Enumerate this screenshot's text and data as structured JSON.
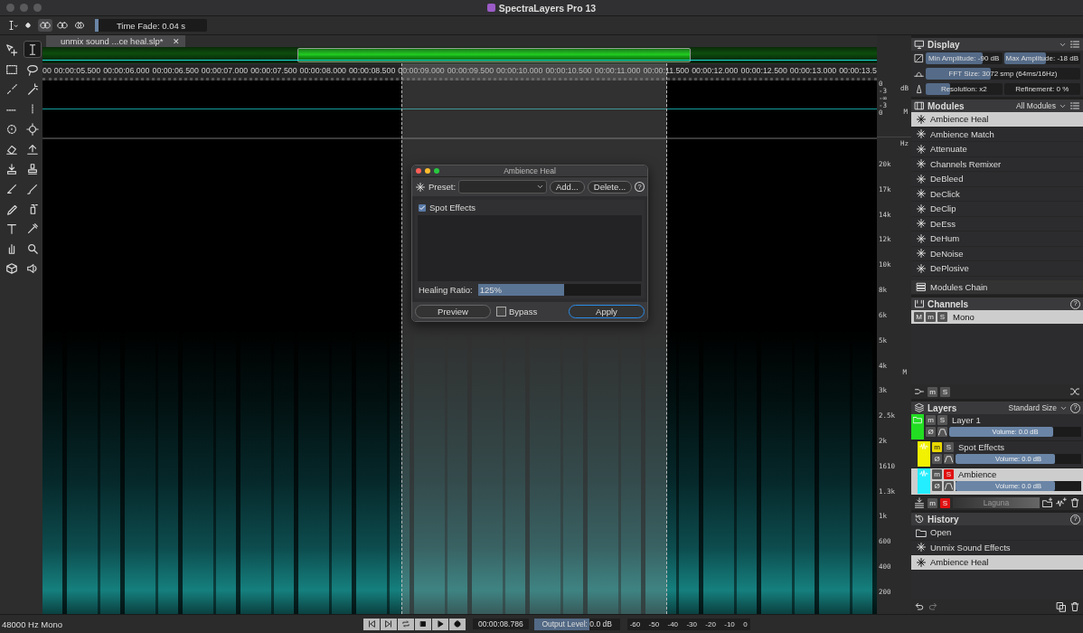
{
  "window": {
    "title": "SpectraLayers Pro 13"
  },
  "toolbar": {
    "modes": [
      {
        "selected": false
      },
      {
        "selected": true
      },
      {
        "selected": false
      },
      {
        "selected": false
      }
    ],
    "time_fade": {
      "text": "Time Fade: 0.04  s",
      "level": 0.03
    }
  },
  "tools": [
    {
      "selected": false
    },
    {
      "selected": true
    },
    {
      "selected": false
    },
    {
      "selected": false
    },
    {
      "selected": false
    },
    {
      "selected": false
    },
    {
      "selected": false
    },
    {
      "selected": false
    },
    {
      "selected": false
    },
    {
      "selected": false
    },
    {
      "selected": false
    },
    {
      "selected": false
    },
    {
      "selected": false
    },
    {
      "selected": false
    },
    {
      "selected": false
    },
    {
      "selected": false
    },
    {
      "selected": false
    },
    {
      "selected": false
    },
    {
      "selected": false
    },
    {
      "selected": false
    },
    {
      "selected": false
    },
    {
      "selected": false
    },
    {
      "selected": false
    },
    {
      "selected": false
    }
  ],
  "tab": {
    "label": "unmix sound ...ce heal.slp*",
    "close": "✕"
  },
  "ruler": {
    "labels": [
      "00",
      "00:00:05.500",
      "00:00:06.000",
      "00:00:06.500",
      "00:00:07.000",
      "00:00:07.500",
      "00:00:08.000",
      "00:00:08.500",
      "00:00:09.000",
      "00:00:09.500",
      "00:00:10.000",
      "00:00:10.500",
      "00:00:11.000",
      "00:00:11.500",
      "00:00:12.000",
      "00:00:12.500",
      "00:00:13.000",
      "00:00:13.5"
    ]
  },
  "waveform": {
    "unit": "dB",
    "channel": "M",
    "db_labels": [
      "0",
      "-3",
      "-∞",
      "-3",
      "0"
    ]
  },
  "frequency_axis": {
    "unit": "Hz",
    "channel": "M",
    "labels": [
      "20k",
      "17k",
      "14k",
      "12k",
      "10k",
      "8k",
      "6k",
      "5k",
      "4k",
      "3k",
      "2.5k",
      "2k",
      "1610",
      "1.3k",
      "1k",
      "600",
      "400",
      "200"
    ]
  },
  "display": {
    "title": "Display",
    "rows": [
      [
        {
          "kind": "slider",
          "text": "Min Amplitude: -90 dB",
          "level": 0.75
        },
        {
          "kind": "slider",
          "text": "Max Amplitude: -18 dB",
          "level": 0.55
        }
      ],
      [
        {
          "kind": "slider",
          "text": "FFT Size: 3072 smp (64ms/16Hz)",
          "level": 0.42
        }
      ],
      [
        {
          "kind": "slider",
          "text": "Resolution: x2",
          "level": 0.32
        },
        {
          "kind": "field",
          "text": "Refinement: 0 %"
        }
      ]
    ]
  },
  "modules": {
    "title": "Modules",
    "filter": "All Modules",
    "items": [
      {
        "label": "Ambience Heal",
        "selected": true
      },
      {
        "label": "Ambience Match",
        "selected": false
      },
      {
        "label": "Attenuate",
        "selected": false
      },
      {
        "label": "Channels Remixer",
        "selected": false
      },
      {
        "label": "DeBleed",
        "selected": false
      },
      {
        "label": "DeClick",
        "selected": false
      },
      {
        "label": "DeClip",
        "selected": false
      },
      {
        "label": "DeEss",
        "selected": false
      },
      {
        "label": "DeHum",
        "selected": false
      },
      {
        "label": "DeNoise",
        "selected": false
      },
      {
        "label": "DePlosive",
        "selected": false
      }
    ],
    "chain": "Modules Chain"
  },
  "channels": {
    "title": "Channels",
    "help": "?",
    "rows": [
      {
        "buttons": [
          "M",
          "m",
          "S"
        ],
        "label": "Mono",
        "selected": true
      }
    ],
    "footer_buttons": [
      "m",
      "S"
    ]
  },
  "layers": {
    "title": "Layers",
    "size": "Standard Size",
    "help": "?",
    "items": [
      {
        "kind": "group",
        "name": "Layer 1",
        "color": "#22dd22",
        "selected": false,
        "mute": {
          "label": "m",
          "on": false
        },
        "solo": {
          "label": "S",
          "on": false
        },
        "phase": "Ø",
        "volume": {
          "text": "Volume: 0.0 dB",
          "level": 0.79
        },
        "children": [
          {
            "kind": "audio",
            "name": "Spot Effects",
            "color": "#f2f200",
            "selected": false,
            "mute": {
              "label": "m",
              "on": true
            },
            "solo": {
              "label": "S",
              "on": false
            },
            "phase": "Ø",
            "volume": {
              "text": "Volume: 0.0 dB",
              "level": 0.79
            }
          },
          {
            "kind": "audio",
            "name": "Ambience",
            "color": "#22eeff",
            "selected": true,
            "mute": {
              "label": "m",
              "on": false
            },
            "solo": {
              "label": "S",
              "on": true
            },
            "phase": "Ø",
            "volume": {
              "text": "Volume: 0.0 dB",
              "level": 0.79
            }
          }
        ]
      }
    ],
    "footer": {
      "mute": {
        "label": "m",
        "on": false
      },
      "solo": {
        "label": "S",
        "on": true
      },
      "preset": "Laguna"
    }
  },
  "history": {
    "title": "History",
    "help": "?",
    "items": [
      {
        "label": "Open",
        "selected": false
      },
      {
        "label": "Unmix Sound Effects",
        "selected": false
      },
      {
        "label": "Ambience Heal",
        "selected": true
      }
    ]
  },
  "dialog": {
    "title": "Ambience Heal",
    "preset_label": "Preset:",
    "add": "Add...",
    "delete": "Delete...",
    "help": "?",
    "option": {
      "label": "Spot Effects",
      "checked": true
    },
    "ratio": {
      "label": "Healing Ratio:",
      "value": "125%",
      "level": 0.53
    },
    "preview": "Preview",
    "bypass": {
      "label": "Bypass",
      "on": false
    },
    "apply": "Apply"
  },
  "status_bar": {
    "format": "48000 Hz Mono",
    "time": "00:00:08.786",
    "output": {
      "text": "Output Level: 0.0 dB",
      "level": 0.65
    },
    "meter_labels": [
      "-60",
      "-50",
      "-40",
      "-30",
      "-20",
      "-10",
      "0"
    ]
  }
}
